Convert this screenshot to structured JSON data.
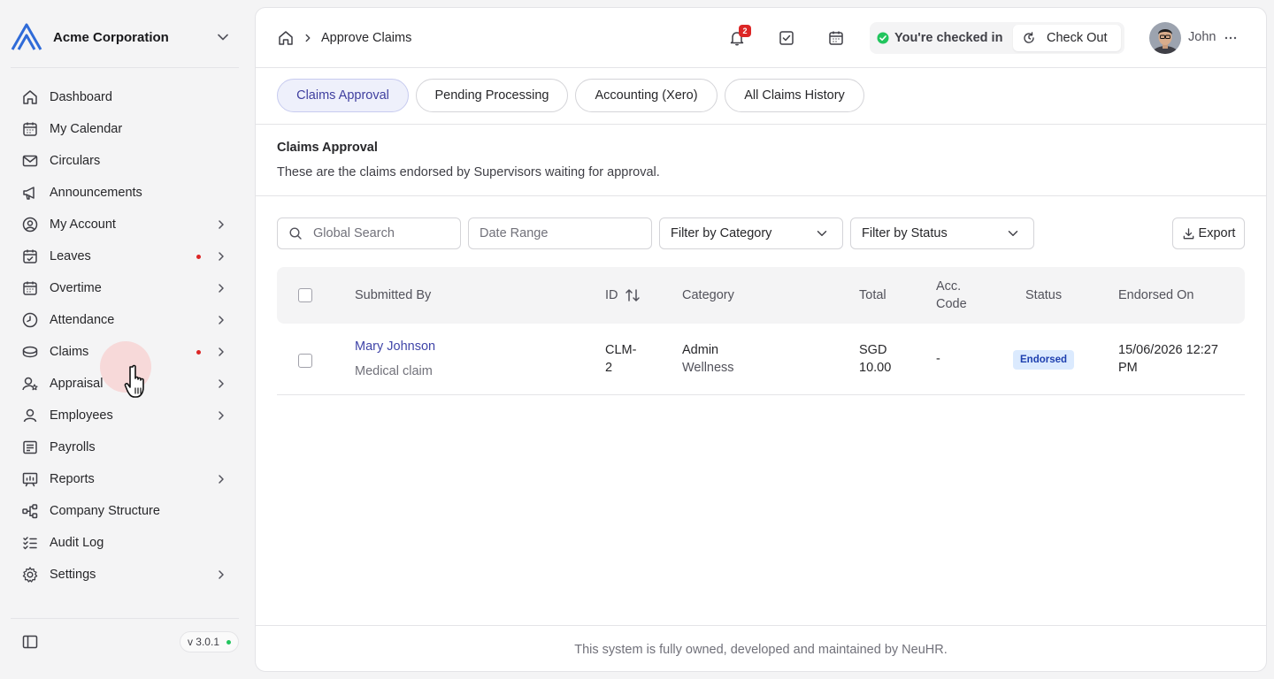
{
  "org": {
    "name": "Acme Corporation",
    "logo_icon": "acme-logo-icon"
  },
  "sidebar": {
    "items": [
      {
        "label": "Dashboard",
        "icon": "home-icon"
      },
      {
        "label": "My Calendar",
        "icon": "calendar-icon"
      },
      {
        "label": "Circulars",
        "icon": "mail-icon"
      },
      {
        "label": "Announcements",
        "icon": "megaphone-icon"
      },
      {
        "label": "My Account",
        "icon": "user-circle-icon"
      },
      {
        "label": "Leaves",
        "icon": "calendar-check-icon"
      },
      {
        "label": "Overtime",
        "icon": "calendar-clock-icon"
      },
      {
        "label": "Attendance",
        "icon": "clock-icon"
      },
      {
        "label": "Claims",
        "icon": "coins-icon"
      },
      {
        "label": "Appraisal",
        "icon": "user-star-icon"
      },
      {
        "label": "Employees",
        "icon": "user-icon"
      },
      {
        "label": "Payrolls",
        "icon": "receipt-icon"
      },
      {
        "label": "Reports",
        "icon": "presentation-icon"
      },
      {
        "label": "Company Structure",
        "icon": "org-chart-icon"
      },
      {
        "label": "Audit Log",
        "icon": "list-checks-icon"
      },
      {
        "label": "Settings",
        "icon": "gear-icon"
      }
    ],
    "version": "v 3.0.1"
  },
  "topbar": {
    "breadcrumb_current": "Approve Claims",
    "notification_count": "2",
    "checkin_status": "You're checked in",
    "checkout_label": "Check Out",
    "user_name": "John"
  },
  "tabs": [
    {
      "label": "Claims Approval",
      "active": true
    },
    {
      "label": "Pending Processing",
      "active": false
    },
    {
      "label": "Accounting (Xero)",
      "active": false
    },
    {
      "label": "All Claims History",
      "active": false
    }
  ],
  "section": {
    "title": "Claims Approval",
    "description": "These are the claims endorsed by Supervisors waiting for approval."
  },
  "filters": {
    "search_placeholder": "Global Search",
    "date_placeholder": "Date Range",
    "category_label": "Filter by Category",
    "status_label": "Filter by Status",
    "export_label": "Export"
  },
  "table": {
    "headers": {
      "submitted_by": "Submitted By",
      "id": "ID",
      "category": "Category",
      "total": "Total",
      "acc_code_1": "Acc.",
      "acc_code_2": "Code",
      "status": "Status",
      "endorsed_on": "Endorsed On"
    },
    "rows": [
      {
        "name": "Mary Johnson",
        "claim_type": "Medical claim",
        "id_1": "CLM-",
        "id_2": "2",
        "category_1": "Admin",
        "category_2": "Wellness",
        "total_1": "SGD",
        "total_2": "10.00",
        "acc_code": "-",
        "status": "Endorsed",
        "endorsed_1": "15/06/2026 12:27",
        "endorsed_2": "PM"
      }
    ]
  },
  "footer": {
    "text": "This system is fully owned, developed and maintained by NeuHR."
  },
  "colors": {
    "accent": "#4045a8",
    "status_green": "#22c55e",
    "alert_red": "#dc2626",
    "badge_bg": "#dbeafe"
  }
}
